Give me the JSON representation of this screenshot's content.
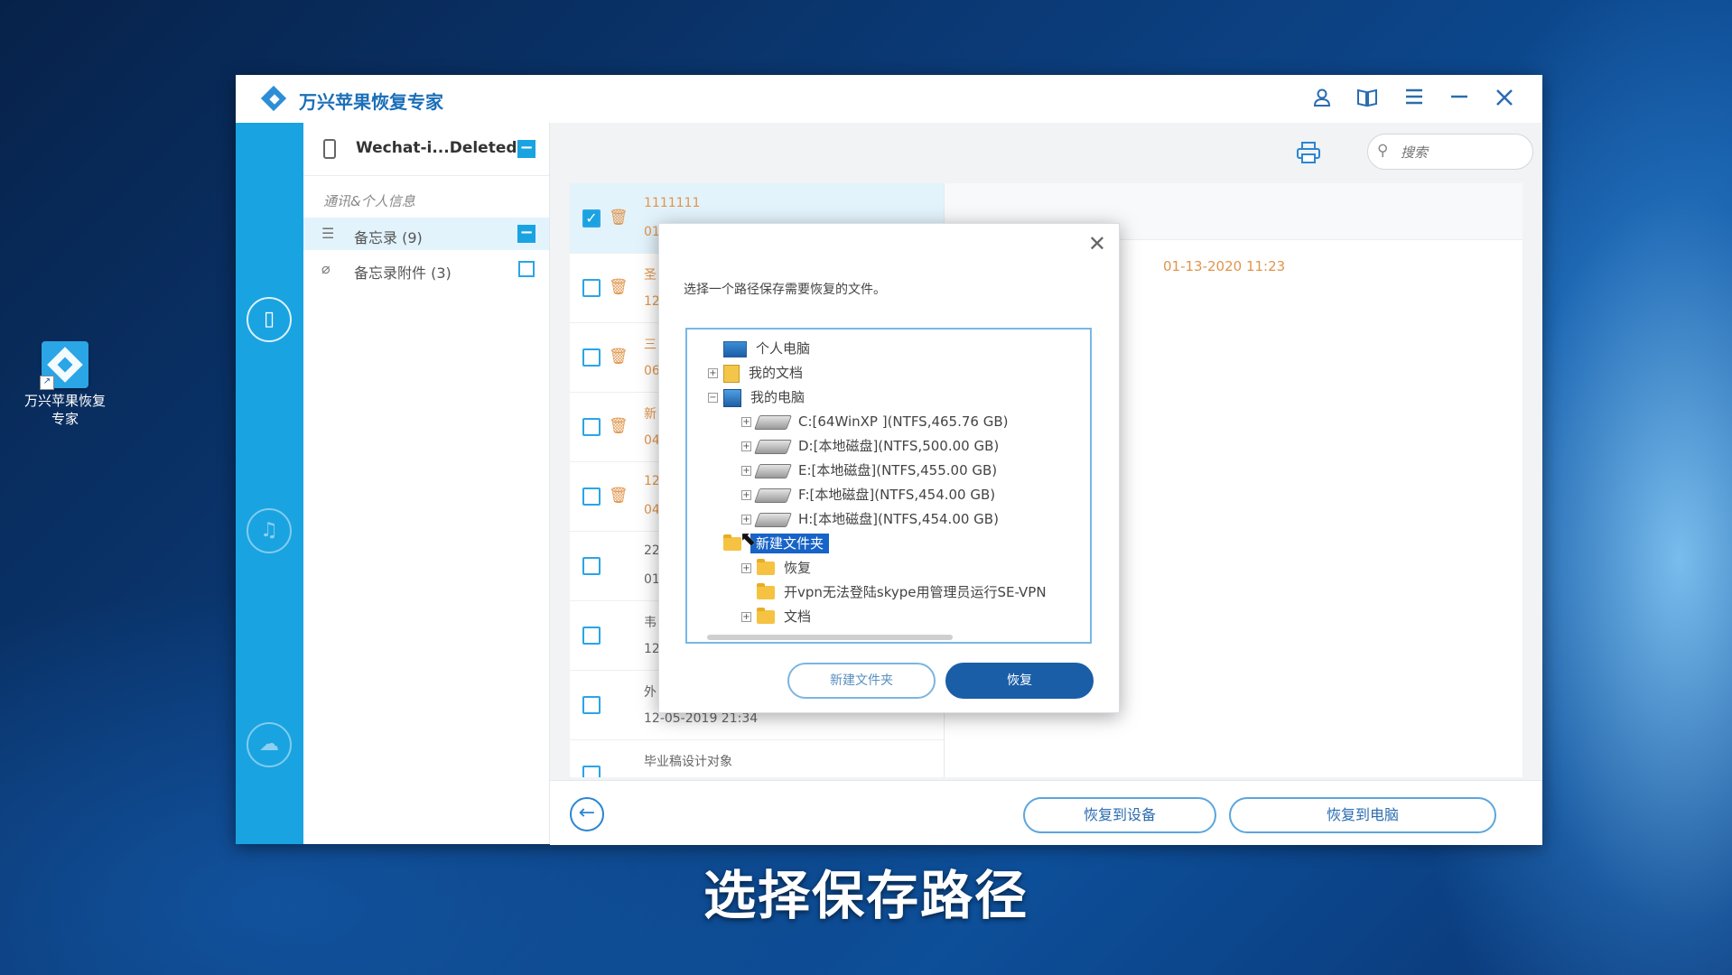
{
  "desktop": {
    "icon_label": "万兴苹果恢复专家"
  },
  "app": {
    "title": "万兴苹果恢复专家",
    "titlebar_icons": [
      "user-icon",
      "book-icon",
      "menu-icon",
      "minimize-icon",
      "close-icon"
    ]
  },
  "sidebar": {
    "icons": [
      "device-recover-icon",
      "itunes-icon",
      "icloud-icon"
    ]
  },
  "category_panel": {
    "device_name": "Wechat-i...Deleted",
    "section_label": "通讯&个人信息",
    "items": [
      {
        "label": "备忘录 (9)",
        "selected": true
      },
      {
        "label": "备忘录附件 (3)",
        "selected": false
      }
    ]
  },
  "toolbar": {
    "search_placeholder": "搜索"
  },
  "list": {
    "rows": [
      {
        "title": "1111111",
        "date": "01",
        "checked": true
      },
      {
        "title": "圣",
        "date": "12",
        "checked": false
      },
      {
        "title": "三",
        "date": "06",
        "checked": false
      },
      {
        "title": "新",
        "date": "04",
        "checked": false
      },
      {
        "title": "12",
        "date": "04",
        "checked": false
      },
      {
        "title": "22",
        "date": "01",
        "checked": false
      },
      {
        "title": "韦",
        "date": "12",
        "checked": false
      },
      {
        "title": "外",
        "date": "12-05-2019 21:34",
        "checked": false
      },
      {
        "title": "毕业稿设计对象",
        "date": "",
        "checked": false
      }
    ]
  },
  "detail": {
    "date": "01-13-2020 11:23"
  },
  "bottom": {
    "restore_device": "恢复到设备",
    "restore_pc": "恢复到电脑"
  },
  "dialog": {
    "message": "选择一个路径保存需要恢复的文件。",
    "tree": [
      {
        "label": "个人电脑",
        "icon": "pc"
      },
      {
        "label": "我的文档",
        "icon": "docs",
        "toggle": "+"
      },
      {
        "label": "我的电脑",
        "icon": "mypc",
        "toggle": "-"
      },
      {
        "label": "C:[64WinXP ](NTFS,465.76 GB)",
        "icon": "drive",
        "toggle": "+"
      },
      {
        "label": "D:[本地磁盘](NTFS,500.00 GB)",
        "icon": "drive",
        "toggle": "+"
      },
      {
        "label": "E:[本地磁盘](NTFS,455.00 GB)",
        "icon": "drive",
        "toggle": "+"
      },
      {
        "label": "F:[本地磁盘](NTFS,454.00 GB)",
        "icon": "drive",
        "toggle": "+"
      },
      {
        "label": "H:[本地磁盘](NTFS,454.00 GB)",
        "icon": "drive",
        "toggle": "+"
      },
      {
        "label": "新建文件夹",
        "icon": "folder",
        "selected": true
      },
      {
        "label": "恢复",
        "icon": "folder",
        "toggle": "+"
      },
      {
        "label": "开vpn无法登陆skype用管理员运行SE-VPN",
        "icon": "folder"
      },
      {
        "label": "文档",
        "icon": "folder",
        "toggle": "+"
      }
    ],
    "new_folder_button": "新建文件夹",
    "recover_button": "恢复"
  },
  "caption": "选择保存路径"
}
